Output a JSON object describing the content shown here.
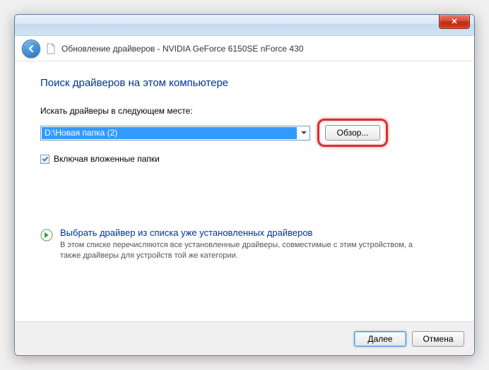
{
  "titlebar": {
    "close_glyph": "✕"
  },
  "header": {
    "title": "Обновление драйверов - NVIDIA GeForce 6150SE nForce 430"
  },
  "main": {
    "heading": "Поиск драйверов на этом компьютере",
    "search_label": "Искать драйверы в следующем месте:",
    "path_value": "D:\\Новая папка (2)",
    "browse_label": "Обзор...",
    "include_sub_label": "Включая вложенные папки",
    "include_sub_checked": true,
    "pick_title": "Выбрать драйвер из списка уже установленных драйверов",
    "pick_desc": "В этом списке перечисляются все установленные драйверы, совместимые с этим устройством, а также драйверы для устройств той же категории."
  },
  "footer": {
    "next_label": "Далее",
    "cancel_label": "Отмена"
  }
}
